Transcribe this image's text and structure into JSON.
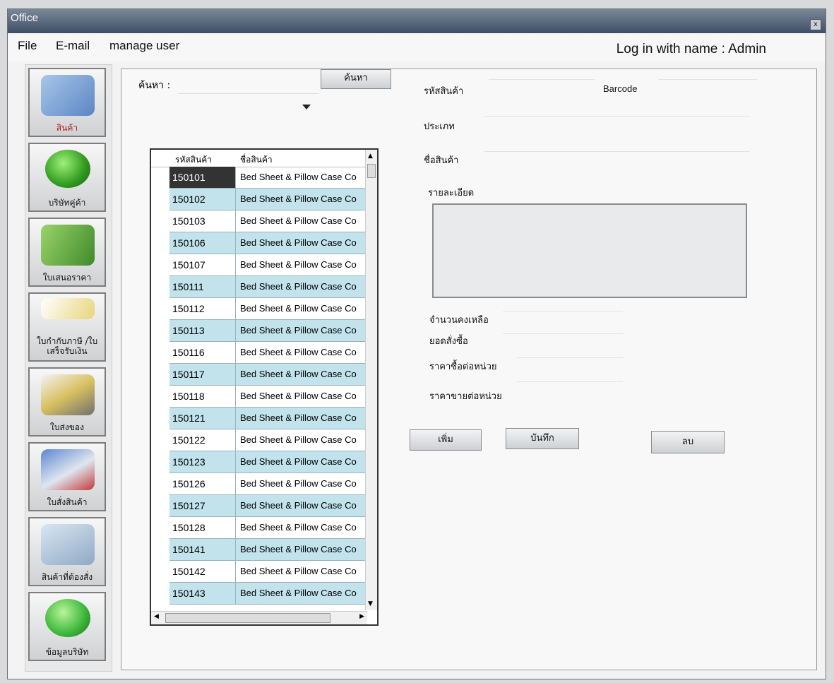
{
  "window": {
    "title": "Office",
    "close_label": "x"
  },
  "menu": {
    "items": [
      "File",
      "E-mail",
      "manage user"
    ],
    "login_text": "Log in with name : Admin"
  },
  "sidebar": {
    "items": [
      {
        "label": "สินค้า",
        "icon": "product-icon"
      },
      {
        "label": "บริษัทคู่ค้า",
        "icon": "partner-company-icon"
      },
      {
        "label": "ใบเสนอราคา",
        "icon": "quotation-icon"
      },
      {
        "label": "ใบกำกับภาษี /ใบเสร็จรับเงิน",
        "icon": "tax-invoice-icon"
      },
      {
        "label": "ใบส่งของ",
        "icon": "delivery-note-icon"
      },
      {
        "label": "ใบสั่งสินค้า",
        "icon": "purchase-order-icon"
      },
      {
        "label": "สินค้าที่ต้องสั่ง",
        "icon": "items-to-order-icon"
      },
      {
        "label": "ข้อมูลบริษัท",
        "icon": "company-info-icon"
      }
    ]
  },
  "search": {
    "label": "ค้นหา :",
    "button_label": "ค้นหา",
    "value": ""
  },
  "table": {
    "headers": [
      "รหัสสินค้า",
      "ชื่อสินค้า"
    ],
    "rows": [
      {
        "code": "150101",
        "name": "Bed Sheet & Pillow Case Co"
      },
      {
        "code": "150102",
        "name": "Bed Sheet & Pillow Case Co"
      },
      {
        "code": "150103",
        "name": "Bed Sheet & Pillow Case Co"
      },
      {
        "code": "150106",
        "name": "Bed Sheet & Pillow Case Co"
      },
      {
        "code": "150107",
        "name": "Bed Sheet & Pillow Case Co"
      },
      {
        "code": "150111",
        "name": "Bed Sheet & Pillow Case Co"
      },
      {
        "code": "150112",
        "name": "Bed Sheet & Pillow Case Co"
      },
      {
        "code": "150113",
        "name": "Bed Sheet & Pillow Case Co"
      },
      {
        "code": "150116",
        "name": "Bed Sheet & Pillow Case Co"
      },
      {
        "code": "150117",
        "name": "Bed Sheet & Pillow Case Co"
      },
      {
        "code": "150118",
        "name": "Bed Sheet & Pillow Case Co"
      },
      {
        "code": "150121",
        "name": "Bed Sheet & Pillow Case Co"
      },
      {
        "code": "150122",
        "name": "Bed Sheet & Pillow Case Co"
      },
      {
        "code": "150123",
        "name": "Bed Sheet & Pillow Case Co"
      },
      {
        "code": "150126",
        "name": "Bed Sheet & Pillow Case Co"
      },
      {
        "code": "150127",
        "name": "Bed Sheet & Pillow Case Co"
      },
      {
        "code": "150128",
        "name": "Bed Sheet & Pillow Case Co"
      },
      {
        "code": "150141",
        "name": "Bed Sheet & Pillow Case Co"
      },
      {
        "code": "150142",
        "name": "Bed Sheet & Pillow Case Co"
      },
      {
        "code": "150143",
        "name": "Bed Sheet & Pillow Case Co"
      }
    ]
  },
  "form": {
    "product_code_label": "รหัสสินค้า",
    "barcode_label": "Barcode",
    "type_label": "ประเภท",
    "product_name_label": "ชื่อสินค้า",
    "detail_label": "รายละเอียด",
    "stock_label": "จำนวนคงเหลือ",
    "order_total_label": "ยอดสั่งซื้อ",
    "buy_price_label": "ราคาซื้อต่อหน่วย",
    "sell_price_label": "ราคาขายต่อหน่วย",
    "add_button": "เพิ่ม",
    "save_button": "บันทึก",
    "delete_button": "ลบ"
  },
  "colors": {
    "alt_row": "#c2e3ec",
    "selected_cell": "#333333",
    "titlebar": "#4b5a70"
  }
}
